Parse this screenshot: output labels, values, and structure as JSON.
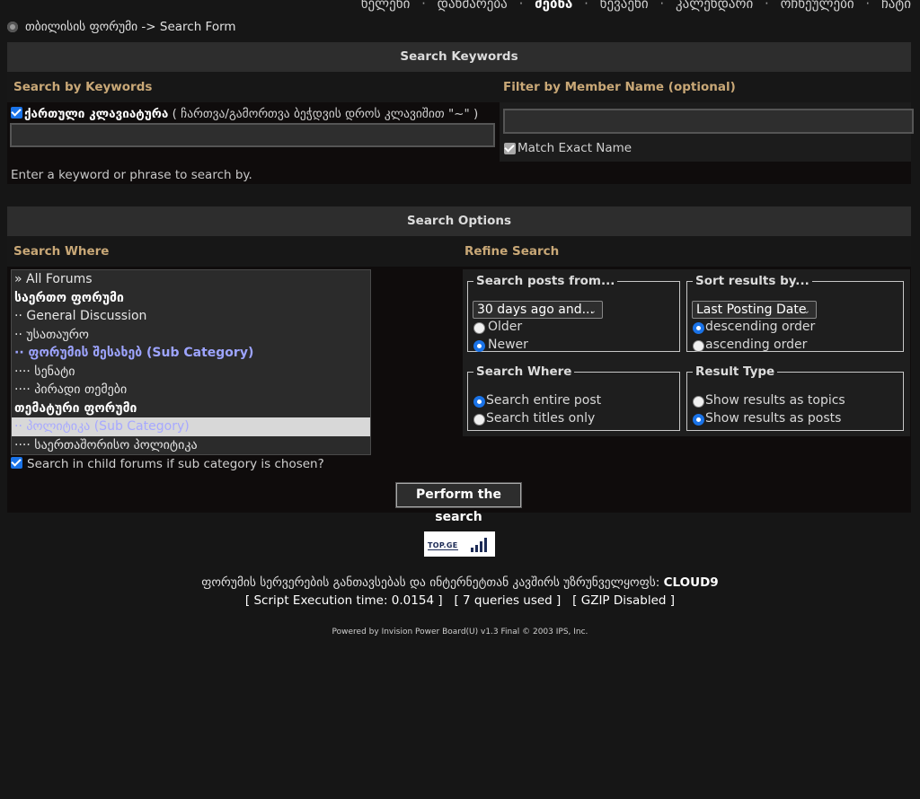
{
  "nav": {
    "items": [
      "ხელეხი",
      "დახმარება",
      "ძებნა",
      "ხევაეხი",
      "კალენდარი",
      "ოჩხეულები",
      "ჩატი"
    ],
    "active_index": 2
  },
  "breadcrumb": {
    "forum": "თბილისის ფორუმი",
    "separator": " -> ",
    "page": "Search Form"
  },
  "keywords": {
    "header": "Search Keywords",
    "left_title": "Search by Keywords",
    "right_title": "Filter by Member Name (optional)",
    "georgian_kbd_label": "ქართული კლავიატურა",
    "georgian_kbd_hint": " ( ჩართვა/გამორთვა ბეჭდვის დროს კლავიშით \"~\" )",
    "keyword_value": "",
    "member_value": "",
    "match_exact_label": "Match Exact Name",
    "help_text": "Enter a keyword or phrase to search by."
  },
  "options": {
    "header": "Search Options",
    "left_title": "Search Where",
    "right_title": "Refine Search",
    "forum_list": [
      {
        "label": "» All Forums",
        "style": "normal"
      },
      {
        "label": "საერთო ფორუმი",
        "style": "bold"
      },
      {
        "label": "·· General Discussion",
        "style": "normal"
      },
      {
        "label": "·· უსათაურო",
        "style": "normal"
      },
      {
        "label": "·· ფორუმის შესახებ (Sub Category)",
        "style": "subcat"
      },
      {
        "label": "···· სენატი",
        "style": "normal"
      },
      {
        "label": "···· პირადი თემები",
        "style": "normal"
      },
      {
        "label": "თემატური ფორუმი",
        "style": "bold"
      },
      {
        "label": "·· პოლიტიკა (Sub Category)",
        "style": "selected"
      },
      {
        "label": "···· საერთაშორისო პოლიტიკა",
        "style": "normal"
      }
    ],
    "child_forums_label": "Search in child forums if sub category is chosen?",
    "posts_from": {
      "legend": "Search posts from...",
      "selected": "30 days ago and...",
      "older": "Older",
      "newer": "Newer"
    },
    "sort_by": {
      "legend": "Sort results by...",
      "selected": "Last Posting Date",
      "desc": "descending order",
      "asc": "ascending order"
    },
    "search_where": {
      "legend": "Search Where",
      "entire": "Search entire post",
      "titles": "Search titles only"
    },
    "result_type": {
      "legend": "Result Type",
      "topics": "Show results as topics",
      "posts": "Show results as posts"
    }
  },
  "submit_label": "Perform the search",
  "logo_text": "TOP.GE",
  "footer": {
    "hosting_text": "ფორუმის სერვერების განთავსებას და ინტერნეტთან კავშირს უზრუნველყოფს: ",
    "hosting_brand": "CLOUD9",
    "stats": "[ Script Execution time: 0.0154 ]   [ 7 queries used ]   [ GZIP Disabled ]",
    "powered": "Powered by Invision Power Board(U) v1.3 Final © 2003  IPS, Inc."
  },
  "icons": {
    "breadcrumb_icon": "forum-dot-icon",
    "dropdown_icon": "chevron-down-icon"
  }
}
